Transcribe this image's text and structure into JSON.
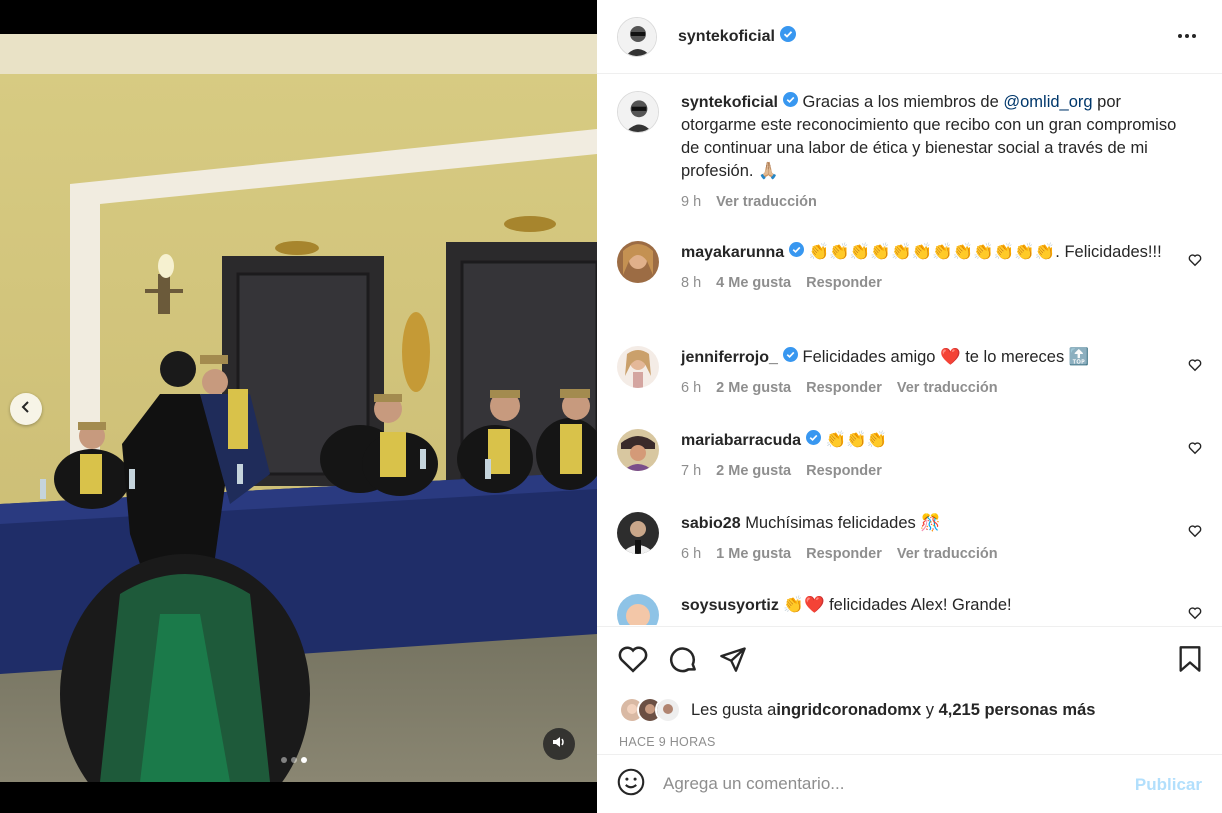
{
  "post": {
    "author": "syntekoficial",
    "caption": {
      "username": "syntekoficial",
      "text_before": "Gracias a los miembros de ",
      "mention": "@omlid_org",
      "text_after": " por otorgarme este reconocimiento que recibo con un gran compromiso de continuar una labor de ética y bienestar social a través de mi profesión. 🙏🏼",
      "time": "9 h",
      "translate": "Ver traducción"
    }
  },
  "comments": [
    {
      "username": "mayakarunna",
      "text": "👏👏👏👏👏👏👏👏👏👏👏👏. Felicidades!!!",
      "time": "8 h",
      "likes": "4 Me gusta",
      "reply": "Responder",
      "translate": ""
    },
    {
      "username": "jenniferrojo_",
      "text": "Felicidades amigo ❤️ te lo mereces 🔝",
      "time": "6 h",
      "likes": "2 Me gusta",
      "reply": "Responder",
      "translate": "Ver traducción"
    },
    {
      "username": "mariabarracuda",
      "text": "👏👏👏",
      "time": "7 h",
      "likes": "2 Me gusta",
      "reply": "Responder",
      "translate": ""
    },
    {
      "username": "sabio28",
      "text": "Muchísimas felicidades 🎊",
      "time": "6 h",
      "likes": "1 Me gusta",
      "reply": "Responder",
      "translate": "Ver traducción"
    },
    {
      "username": "soysusyortiz",
      "text": "👏❤️ felicidades Alex! Grande!",
      "time": "",
      "likes": "",
      "reply": "",
      "translate": ""
    }
  ],
  "likes_line": {
    "prefix": "Les gusta a ",
    "user": "ingridcoronadomx",
    "mid": " y ",
    "others": "4,215 personas más"
  },
  "time_ago": "HACE 9 HORAS",
  "comment_box": {
    "placeholder": "Agrega un comentario...",
    "publish": "Publicar"
  },
  "icons": {
    "more": "more-horizontal-icon",
    "like": "heart-icon",
    "comment": "comment-bubble-icon",
    "share": "paper-plane-icon",
    "save": "bookmark-icon",
    "emoji": "smiley-icon",
    "prev": "chevron-left-icon",
    "audio": "speaker-icon",
    "verified": "verified-badge-icon"
  },
  "colors": {
    "verified": "#3897f0",
    "link": "#00376b",
    "publish": "#b2dffc",
    "muted": "#8e8e8e"
  },
  "carousel": {
    "slides": 3,
    "active_index": 2
  }
}
